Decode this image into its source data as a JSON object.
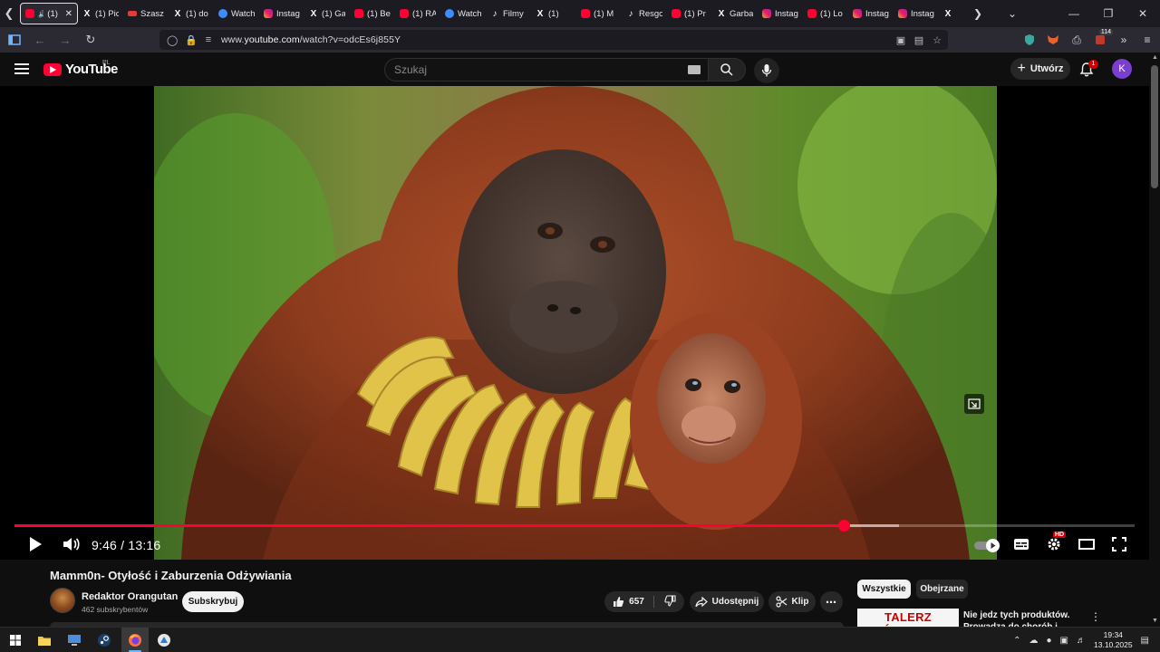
{
  "browser": {
    "tabs": [
      {
        "icon": "youtube-icon",
        "label": "(1) N",
        "active": true
      },
      {
        "icon": "x-icon",
        "label": "(1) Pic"
      },
      {
        "icon": "szaszlyk-icon",
        "label": "Szasz"
      },
      {
        "icon": "x-icon",
        "label": "(1) do"
      },
      {
        "icon": "watch-icon",
        "label": "Watch"
      },
      {
        "icon": "instagram-icon",
        "label": "Instag"
      },
      {
        "icon": "x-icon",
        "label": "(1) Ga"
      },
      {
        "icon": "youtube-icon",
        "label": "(1) Be"
      },
      {
        "icon": "youtube-icon",
        "label": "(1) RA"
      },
      {
        "icon": "watch-icon",
        "label": "Watch"
      },
      {
        "icon": "tiktok-icon",
        "label": "Filmy"
      },
      {
        "icon": "x-icon",
        "label": "(1)"
      },
      {
        "icon": "youtube-icon",
        "label": "(1) M"
      },
      {
        "icon": "tiktok-icon",
        "label": "Resgo"
      },
      {
        "icon": "youtube-icon",
        "label": "(1) Pr"
      },
      {
        "icon": "x-icon",
        "label": "Garba"
      },
      {
        "icon": "instagram-icon",
        "label": "Instag"
      },
      {
        "icon": "youtube-icon",
        "label": "(1) Lo"
      },
      {
        "icon": "instagram-icon",
        "label": "Instag"
      },
      {
        "icon": "instagram-icon",
        "label": "Instag"
      },
      {
        "icon": "x-icon",
        "label": ""
      }
    ],
    "url_prefix": "www.",
    "url_host": "youtube.com",
    "url_path": "/watch?v=odcEs6j855Y",
    "extensions_badge": "114"
  },
  "youtube": {
    "logo_text": "YouTube",
    "region": "PL",
    "search_placeholder": "Szukaj",
    "create_label": "Utwórz",
    "notifications_count": "1",
    "avatar_letter": "K"
  },
  "player": {
    "current_time": "9:46",
    "duration": "13:16",
    "time_separator": " / ",
    "progress_fraction": 0.74,
    "buffer_fraction": 0.79,
    "hd_label": "HD"
  },
  "video": {
    "title": "Mamm0n- Otyłość i Zaburzenia Odżywiania",
    "channel_name": "Redaktor Orangutan",
    "subscribers": "462 subskrybentów",
    "subscribe_label": "Subskrybuj",
    "likes": "657",
    "share_label": "Udostępnij",
    "clip_label": "Klip"
  },
  "sidebar": {
    "chips": [
      "Wszystkie",
      "Obejrzane"
    ],
    "recommendation": {
      "thumbnail_text": "TALERZ ŚMIERCI",
      "title": "Nie jedz tych produktów. Prowadzą do chorób i skracają"
    }
  },
  "taskbar": {
    "time": "19:34",
    "date": "13.10.2025"
  },
  "colors": {
    "youtube_red": "#ff0033",
    "background": "#0f0f0f",
    "avatar": "#7b3fd0"
  }
}
